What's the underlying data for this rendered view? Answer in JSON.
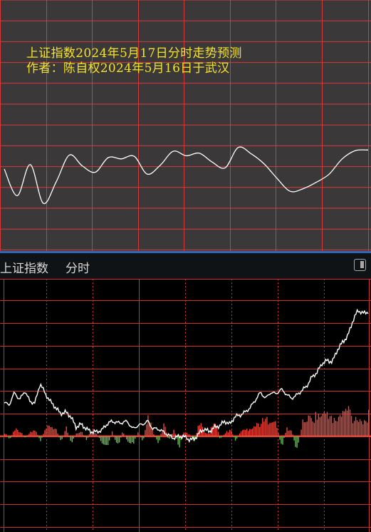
{
  "forecast": {
    "title_line1": "上证指数2024年5月17日分时走势预测",
    "title_line2": "作者：陈自权2024年5月16日于武汉",
    "colors": {
      "background": "#3b3839",
      "grid": "#d43a3a",
      "curve": "#ffffff",
      "caption": "#f5e32a"
    },
    "chart_data": {
      "type": "line",
      "series": [
        {
          "values": [
            0.64,
            0.22,
            0.71,
            0.1,
            0.44,
            0.86,
            0.69,
            0.59,
            0.82,
            0.8,
            0.84,
            0.56,
            0.7,
            0.92,
            0.85,
            0.89,
            0.75,
            0.66,
            0.98,
            0.88,
            0.72,
            0.49,
            0.29,
            0.33,
            0.43,
            0.56,
            0.8,
            0.93,
            0.94
          ]
        }
      ]
    }
  },
  "header": {
    "index_name": "上证指数",
    "mode_label": "分时",
    "toggle_icon": "panel-toggle-icon"
  },
  "intraday": {
    "colors": {
      "grid": "#c83232",
      "price_line": "#ffffff",
      "up_bar": "#e8463c",
      "down_bar": "#5cc04a"
    },
    "chart_data": {
      "type": "line",
      "series": [
        {
          "name": "price",
          "values": [
            0.38,
            0.37,
            0.45,
            0.4,
            0.46,
            0.39,
            0.38,
            0.51,
            0.44,
            0.39,
            0.35,
            0.31,
            0.32,
            0.29,
            0.22,
            0.24,
            0.21,
            0.19,
            0.19,
            0.2,
            0.24,
            0.26,
            0.25,
            0.25,
            0.26,
            0.21,
            0.23,
            0.24,
            0.26,
            0.21,
            0.21,
            0.19,
            0.17,
            0.15,
            0.16,
            0.16,
            0.14,
            0.14,
            0.18,
            0.21,
            0.19,
            0.22,
            0.23,
            0.26,
            0.24,
            0.29,
            0.3,
            0.32,
            0.35,
            0.4,
            0.45,
            0.41,
            0.45,
            0.44,
            0.47,
            0.44,
            0.41,
            0.43,
            0.46,
            0.49,
            0.55,
            0.58,
            0.64,
            0.66,
            0.65,
            0.73,
            0.78,
            0.82,
            0.92,
            0.99,
            0.97,
            0.98
          ]
        },
        {
          "name": "volume",
          "values": [
            0.1,
            -0.08,
            0.22,
            0.15,
            -0.05,
            0.12,
            0.16,
            -0.12,
            0.2,
            0.3,
            0.18,
            -0.15,
            0.25,
            -0.2,
            0.1,
            0.14,
            -0.1,
            0.22,
            0.08,
            -0.18,
            -0.25,
            0.15,
            -0.3,
            0.12,
            -0.14,
            -0.22,
            0.1,
            -0.12,
            0.55,
            0.08,
            -0.2,
            0.35,
            -0.1,
            0.18,
            -0.28,
            0.12,
            0.06,
            -0.16,
            0.4,
            0.1,
            0.1,
            0.52,
            -0.08,
            0.08,
            0.2,
            -0.12,
            0.14,
            0.18,
            0.25,
            0.3,
            0.38,
            0.45,
            0.5,
            0.32,
            -0.3,
            0.22,
            0.15,
            -0.42,
            0.35,
            0.5,
            0.48,
            0.6,
            0.55,
            0.7,
            0.4,
            0.5,
            0.62,
            0.8,
            0.45,
            0.55,
            0.38,
            0.58
          ]
        }
      ]
    }
  }
}
